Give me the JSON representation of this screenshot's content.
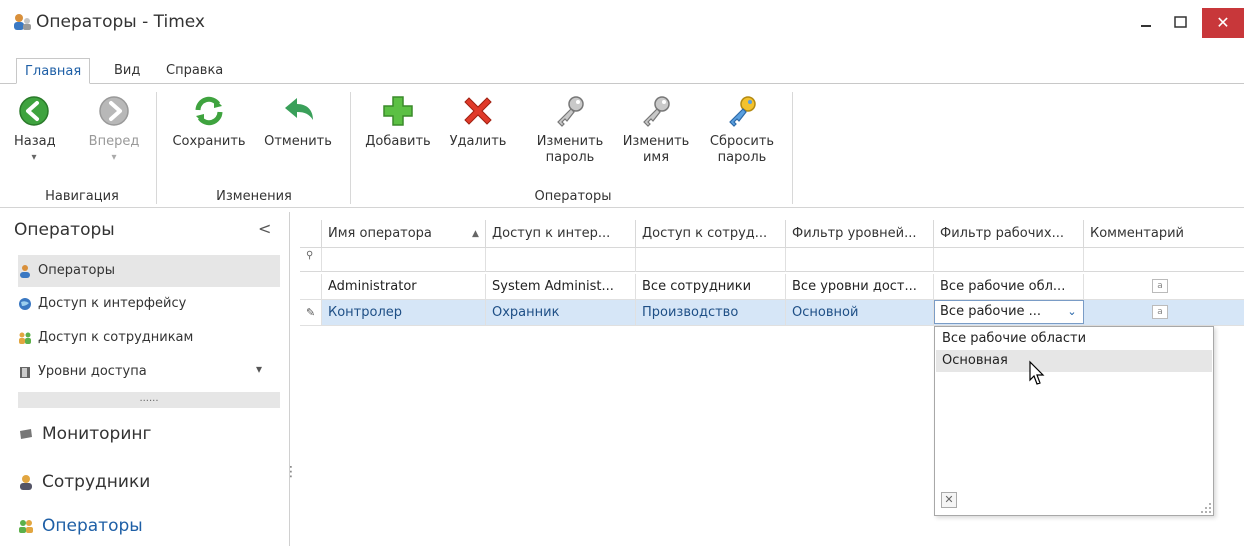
{
  "window": {
    "title": "Операторы - Timex",
    "min": "–",
    "max": "□",
    "close": "✕"
  },
  "tabs": [
    {
      "label": "Главная"
    },
    {
      "label": "Вид"
    },
    {
      "label": "Справка"
    }
  ],
  "ribbon": {
    "back": "Назад",
    "forward": "Вперед",
    "save": "Сохранить",
    "undo": "Отменить",
    "add": "Добавить",
    "delete": "Удалить",
    "change_password_1": "Изменить",
    "change_password_2": "пароль",
    "change_name_1": "Изменить",
    "change_name_2": "имя",
    "reset_password_1": "Сбросить",
    "reset_password_2": "пароль",
    "groups": {
      "nav": "Навигация",
      "changes": "Изменения",
      "operators": "Операторы"
    },
    "arrow": "▾"
  },
  "sidebar": {
    "title": "Операторы",
    "collapse": "<",
    "items": [
      {
        "label": "Операторы"
      },
      {
        "label": "Доступ к интерфейсу"
      },
      {
        "label": "Доступ к сотрудникам"
      },
      {
        "label": "Уровни доступа"
      }
    ],
    "expand": "▾",
    "dots": "......",
    "nav": [
      {
        "label": "Мониторинг"
      },
      {
        "label": "Сотрудники"
      },
      {
        "label": "Операторы"
      }
    ],
    "vdots": "⋮"
  },
  "grid": {
    "columns": [
      "Имя оператора",
      "Доступ к интер...",
      "Доступ к сотруд...",
      "Фильтр уровней...",
      "Фильтр рабочих...",
      "Комментарий"
    ],
    "sort_icon": "▲",
    "filter_icon": "⚲",
    "edit_icon": "✎",
    "rows": [
      [
        "Administrator",
        "System Administ...",
        "Все сотрудники",
        "Все уровни дост...",
        "Все рабочие обл...",
        "a"
      ],
      [
        "Контролер",
        "Охранник",
        "Производство",
        "Основной",
        "",
        "a"
      ]
    ],
    "editor_value": "Все рабочие ...",
    "editor_arrow": "⌄"
  },
  "dropdown": {
    "options": [
      "Все рабочие области",
      "Основная"
    ],
    "close": "✕"
  },
  "colors": {
    "accent": "#1e5fa6",
    "selection": "#d6e6f7",
    "close_btn": "#c8373a"
  }
}
